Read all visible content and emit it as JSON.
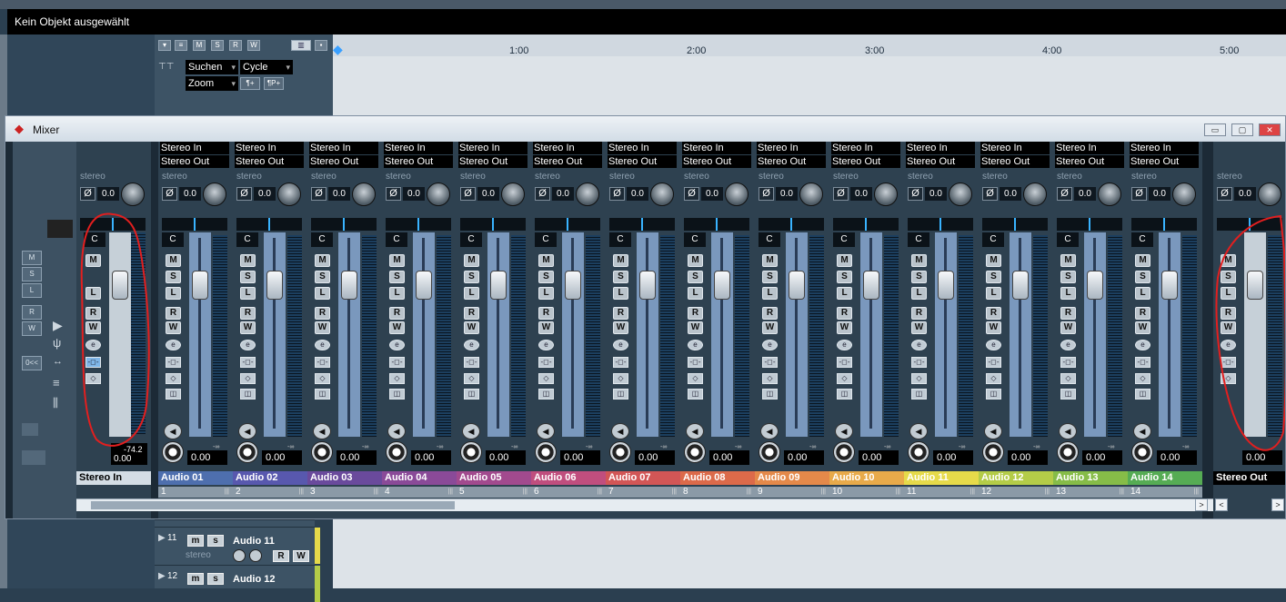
{
  "status": {
    "text": "Kein Objekt ausgewählt"
  },
  "project_toolbar": {
    "search": "Suchen",
    "cycle": "Cycle",
    "zoom": "Zoom",
    "btn_a": "¶+",
    "btn_b": "¶P+",
    "header_buttons": [
      "M",
      "S",
      "R",
      "W"
    ]
  },
  "ruler": {
    "marks": [
      "1:00",
      "2:00",
      "3:00",
      "4:00",
      "5:00"
    ]
  },
  "mixer": {
    "title": "Mixer",
    "window_buttons": [
      "▭",
      "▢",
      "✕"
    ],
    "common_panel_buttons": [
      "M",
      "S",
      "L",
      "R",
      "W",
      "0<<"
    ],
    "input_strip": {
      "stereo": "stereo",
      "gain": "0.0",
      "pan": "C",
      "meter": "-74.2",
      "volume": "0.00",
      "name": "Stereo In"
    },
    "output_strip": {
      "stereo": "stereo",
      "gain": "0.0",
      "volume": "0.00",
      "name": "Stereo Out"
    },
    "channels": [
      {
        "input": "Stereo In",
        "output": "Stereo Out",
        "stereo": "stereo",
        "gain": "0.0",
        "pan": "C",
        "volume": "0.00",
        "peak": "-∞",
        "name": "Audio 01",
        "number": "1",
        "color": "#4e6fae"
      },
      {
        "input": "Stereo In",
        "output": "Stereo Out",
        "stereo": "stereo",
        "gain": "0.0",
        "pan": "C",
        "volume": "0.00",
        "peak": "-∞",
        "name": "Audio 02",
        "number": "2",
        "color": "#5858ae"
      },
      {
        "input": "Stereo In",
        "output": "Stereo Out",
        "stereo": "stereo",
        "gain": "0.0",
        "pan": "C",
        "volume": "0.00",
        "peak": "-∞",
        "name": "Audio 03",
        "number": "3",
        "color": "#6a4a9c"
      },
      {
        "input": "Stereo In",
        "output": "Stereo Out",
        "stereo": "stereo",
        "gain": "0.0",
        "pan": "C",
        "volume": "0.00",
        "peak": "-∞",
        "name": "Audio 04",
        "number": "4",
        "color": "#8a4a98"
      },
      {
        "input": "Stereo In",
        "output": "Stereo Out",
        "stereo": "stereo",
        "gain": "0.0",
        "pan": "C",
        "volume": "0.00",
        "peak": "-∞",
        "name": "Audio 05",
        "number": "5",
        "color": "#a24a8e"
      },
      {
        "input": "Stereo In",
        "output": "Stereo Out",
        "stereo": "stereo",
        "gain": "0.0",
        "pan": "C",
        "volume": "0.00",
        "peak": "-∞",
        "name": "Audio 06",
        "number": "6",
        "color": "#c04e7e"
      },
      {
        "input": "Stereo In",
        "output": "Stereo Out",
        "stereo": "stereo",
        "gain": "0.0",
        "pan": "C",
        "volume": "0.00",
        "peak": "-∞",
        "name": "Audio 07",
        "number": "7",
        "color": "#d25656"
      },
      {
        "input": "Stereo In",
        "output": "Stereo Out",
        "stereo": "stereo",
        "gain": "0.0",
        "pan": "C",
        "volume": "0.00",
        "peak": "-∞",
        "name": "Audio 08",
        "number": "8",
        "color": "#dc6a4a"
      },
      {
        "input": "Stereo In",
        "output": "Stereo Out",
        "stereo": "stereo",
        "gain": "0.0",
        "pan": "C",
        "volume": "0.00",
        "peak": "-∞",
        "name": "Audio 09",
        "number": "9",
        "color": "#e4894a"
      },
      {
        "input": "Stereo In",
        "output": "Stereo Out",
        "stereo": "stereo",
        "gain": "0.0",
        "pan": "C",
        "volume": "0.00",
        "peak": "-∞",
        "name": "Audio 10",
        "number": "10",
        "color": "#e8aa4a"
      },
      {
        "input": "Stereo In",
        "output": "Stereo Out",
        "stereo": "stereo",
        "gain": "0.0",
        "pan": "C",
        "volume": "0.00",
        "peak": "-∞",
        "name": "Audio 11",
        "number": "11",
        "color": "#e6da4a"
      },
      {
        "input": "Stereo In",
        "output": "Stereo Out",
        "stereo": "stereo",
        "gain": "0.0",
        "pan": "C",
        "volume": "0.00",
        "peak": "-∞",
        "name": "Audio 12",
        "number": "12",
        "color": "#b4cc48"
      },
      {
        "input": "Stereo In",
        "output": "Stereo Out",
        "stereo": "stereo",
        "gain": "0.0",
        "pan": "C",
        "volume": "0.00",
        "peak": "-∞",
        "name": "Audio 13",
        "number": "13",
        "color": "#86bc48"
      },
      {
        "input": "Stereo In",
        "output": "Stereo Out",
        "stereo": "stereo",
        "gain": "0.0",
        "pan": "C",
        "volume": "0.00",
        "peak": "-∞",
        "name": "Audio 14",
        "number": "14",
        "color": "#56ac54"
      }
    ]
  },
  "tracks": [
    {
      "number": "11",
      "name": "Audio 11",
      "sub": "stereo",
      "m": "m",
      "s": "s",
      "r": "R",
      "w": "W",
      "color": "#e6da4a"
    },
    {
      "number": "12",
      "name": "Audio 12",
      "sub": "",
      "m": "m",
      "s": "s",
      "r": "R",
      "w": "W",
      "color": "#b4cc48"
    }
  ]
}
